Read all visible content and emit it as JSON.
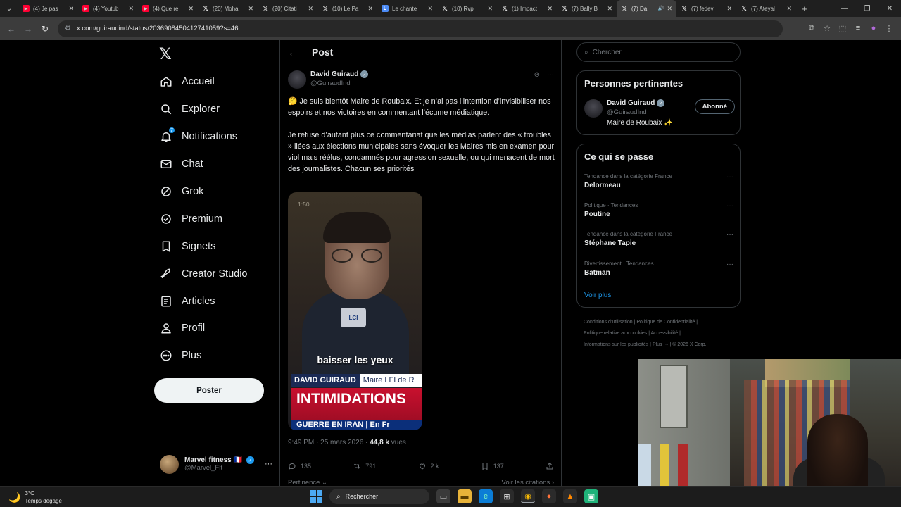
{
  "browser": {
    "tabs": [
      {
        "title": "(4) Je pas",
        "favicon": "youtube-icon",
        "active": false
      },
      {
        "title": "(4) Youtub",
        "favicon": "youtube-icon",
        "active": false
      },
      {
        "title": "(4) Que re",
        "favicon": "youtube-icon",
        "active": false
      },
      {
        "title": "(20) Moha",
        "favicon": "x-icon",
        "active": false
      },
      {
        "title": "(20) Citati",
        "favicon": "x-icon",
        "active": false
      },
      {
        "title": "(10) Le Pa",
        "favicon": "x-icon",
        "active": false
      },
      {
        "title": "Le chante",
        "favicon": "site-icon",
        "active": false
      },
      {
        "title": "(10) Rvpl",
        "favicon": "x-icon",
        "active": false
      },
      {
        "title": "(1) Impact",
        "favicon": "x-icon",
        "active": false
      },
      {
        "title": "(7) Bally B",
        "favicon": "x-icon",
        "active": false
      },
      {
        "title": "(7) Da",
        "favicon": "x-icon",
        "active": true
      },
      {
        "title": "(7) fedev",
        "favicon": "x-icon",
        "active": false
      },
      {
        "title": "(7) Ateyal",
        "favicon": "x-icon",
        "active": false
      }
    ],
    "url": "x.com/guiraudind/status/2036908450412741059?s=46"
  },
  "sidebar": {
    "items": [
      {
        "label": "Accueil",
        "icon": "home-icon"
      },
      {
        "label": "Explorer",
        "icon": "search-icon"
      },
      {
        "label": "Notifications",
        "icon": "bell-icon",
        "badge": "7"
      },
      {
        "label": "Chat",
        "icon": "mail-icon"
      },
      {
        "label": "Grok",
        "icon": "grok-icon"
      },
      {
        "label": "Premium",
        "icon": "premium-icon"
      },
      {
        "label": "Signets",
        "icon": "bookmark-icon"
      },
      {
        "label": "Creator Studio",
        "icon": "rocket-icon"
      },
      {
        "label": "Articles",
        "icon": "article-icon"
      },
      {
        "label": "Profil",
        "icon": "person-icon"
      },
      {
        "label": "Plus",
        "icon": "more-circle-icon"
      }
    ],
    "post_button": "Poster",
    "account": {
      "name": "Marvel fitness",
      "flag": "🇫🇷",
      "handle": "@Marvel_Flt"
    }
  },
  "post": {
    "header_title": "Post",
    "author": {
      "name": "David Guiraud",
      "handle": "@GuiraudInd"
    },
    "paragraphs": [
      "🤔 Je suis bientôt Maire de Roubaix. Et je n’ai pas l’intention d’invisibiliser nos espoirs et nos victoires en commentant l’écume médiatique.",
      "Je refuse d’autant plus ce commentariat que les médias parlent des « troubles » liées aux élections municipales sans évoquer les Maires mis en examen pour viol mais réélus, condamnés pour agression sexuelle, ou qui menacent de mort des journalistes. Chacun ses priorités"
    ],
    "media": {
      "timestamp": "1:50",
      "channel_logo": "LCI",
      "caption": "baisser les yeux",
      "lower_third_name": "DAVID GUIRAUD",
      "lower_third_role": "Maire LFI de R",
      "headline": "INTIMIDATIONS",
      "ticker": "GUERRE EN IRAN | En Fr"
    },
    "time": "9:49 PM",
    "date": "25 mars 2026",
    "views_count": "44,8 k",
    "views_label": "vues",
    "stats": {
      "replies": "135",
      "reposts": "791",
      "likes": "2 k",
      "bookmarks": "137"
    },
    "sort_label": "Pertinence ⌄",
    "quotes_label": "Voir les citations ›"
  },
  "right": {
    "search_placeholder": "Chercher",
    "relevant": {
      "title": "Personnes pertinentes",
      "name": "David Guiraud",
      "handle": "@GuiraudInd",
      "bio": "Maire de Roubaix ✨",
      "follow_label": "Abonné"
    },
    "trends": {
      "title": "Ce qui se passe",
      "items": [
        {
          "category": "Tendance dans la catégorie France",
          "name": "Delormeau"
        },
        {
          "category": "Politique · Tendances",
          "name": "Poutine"
        },
        {
          "category": "Tendance dans la catégorie France",
          "name": "Stéphane Tapie"
        },
        {
          "category": "Divertissement · Tendances",
          "name": "Batman"
        }
      ],
      "more_label": "Voir plus"
    },
    "footer": [
      "Conditions d’utilisation",
      "Politique de Confidentialité",
      "Politique relative aux cookies",
      "Accessibilité",
      "Informations sur les publicités",
      "Plus ···",
      "© 2026 X Corp."
    ]
  },
  "taskbar": {
    "temperature": "3°C",
    "weather": "Temps dégagé",
    "search_label": "Rechercher"
  }
}
